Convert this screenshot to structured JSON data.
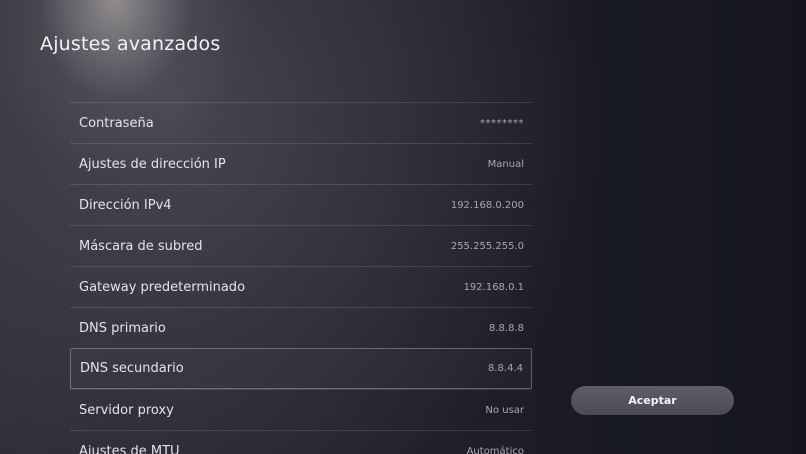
{
  "header": {
    "title": "Ajustes avanzados"
  },
  "settings": [
    {
      "label": "Contraseña",
      "value": "********"
    },
    {
      "label": "Ajustes de dirección IP",
      "value": "Manual"
    },
    {
      "label": "Dirección IPv4",
      "value": "192.168.0.200"
    },
    {
      "label": "Máscara de subred",
      "value": "255.255.255.0"
    },
    {
      "label": "Gateway predeterminado",
      "value": "192.168.0.1"
    },
    {
      "label": "DNS primario",
      "value": "8.8.8.8"
    },
    {
      "label": "DNS secundario",
      "value": "8.8.4.4"
    },
    {
      "label": "Servidor proxy",
      "value": "No usar"
    },
    {
      "label": "Ajustes de MTU",
      "value": "Automático"
    }
  ],
  "actions": {
    "accept_label": "Aceptar"
  }
}
